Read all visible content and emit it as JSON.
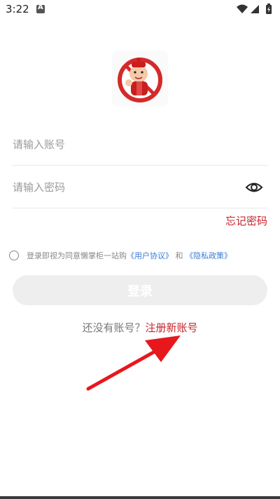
{
  "status_bar": {
    "time": "3:22"
  },
  "login": {
    "account_placeholder": "请输入账号",
    "password_placeholder": "请输入密码",
    "forgot_password": "忘记密码",
    "agreement_prefix": "登录即视为同意懒掌柜一站购",
    "user_agreement": "《用户协议》",
    "agreement_and": "和",
    "privacy_policy": "《隐私政策》",
    "login_button": "登录",
    "register_prompt": "还没有账号？",
    "register_link": "注册新账号"
  },
  "icons": [
    "logo-icon",
    "eye-icon",
    "wifi-icon",
    "signal-icon",
    "battery-icon",
    "arrow-annotation"
  ],
  "colors": {
    "accent_red": "#c8242c",
    "link_blue": "#3a7bd5",
    "button_bg": "#eeeeee"
  }
}
